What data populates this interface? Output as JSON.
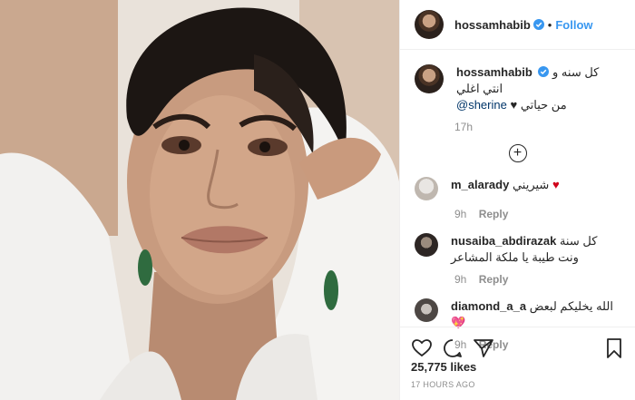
{
  "post": {
    "photo_alt": "",
    "author": "hossamhabib",
    "follow_label": "Follow",
    "dot": "•"
  },
  "caption": {
    "author": "hossamhabib",
    "text": "كل سنه و انتي اغلي",
    "mention": "@sherine",
    "text2": "من حياتي",
    "time": "17h"
  },
  "add_icon": "plus-circle-icon",
  "comments": [
    {
      "user": "m_alarady",
      "text": "شيريني",
      "time": "9h",
      "reply": "Reply"
    },
    {
      "user": "nusaiba_abdirazak",
      "text": "كل سنة ونت طيبة يا ملكة المشاعر",
      "time": "9h",
      "reply": "Reply"
    },
    {
      "user": "diamond_a_a",
      "text": "الله يخليكم لبعض",
      "time": "9h",
      "reply": "Reply"
    }
  ],
  "likes": "25,775 likes",
  "time_ago": "17 HOURS AGO",
  "colors": {
    "link": "#3897f0",
    "verified": "#3897f0",
    "heart": "#d0021b",
    "muted": "#8e8e8e"
  }
}
